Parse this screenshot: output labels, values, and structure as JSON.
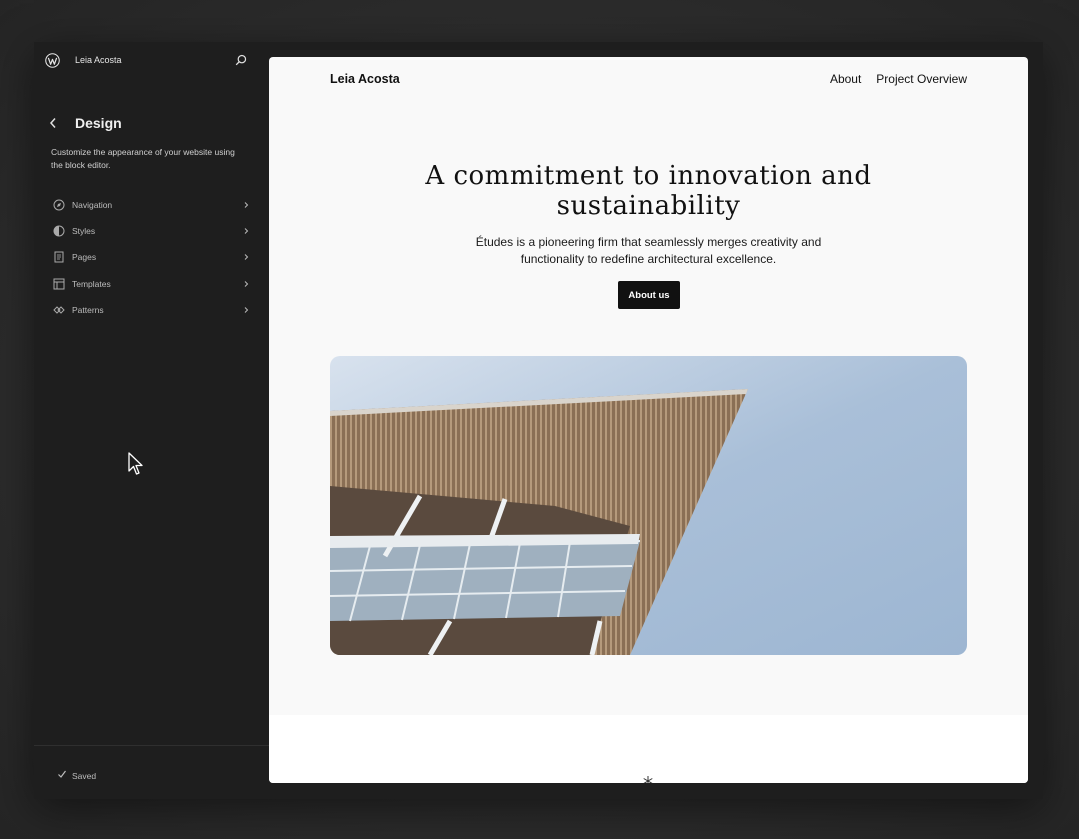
{
  "sidebar": {
    "site_name": "Leia Acosta",
    "title": "Design",
    "description": "Customize the appearance of your website using the block editor.",
    "items": [
      {
        "label": "Navigation",
        "icon": "navigation-icon"
      },
      {
        "label": "Styles",
        "icon": "styles-icon"
      },
      {
        "label": "Pages",
        "icon": "pages-icon"
      },
      {
        "label": "Templates",
        "icon": "templates-icon"
      },
      {
        "label": "Patterns",
        "icon": "patterns-icon"
      }
    ],
    "status": "Saved"
  },
  "preview": {
    "site_title": "Leia Acosta",
    "nav": [
      "About",
      "Project Overview"
    ],
    "hero": {
      "heading": "A commitment to innovation and sustainability",
      "text": "Études is a pioneering firm that seamlessly merges creativity and functionality to redefine architectural excellence.",
      "button": "About us"
    }
  },
  "colors": {
    "app_bg": "#1e1e1e",
    "preview_bg": "#f9f9f9",
    "button_bg": "#111111"
  }
}
